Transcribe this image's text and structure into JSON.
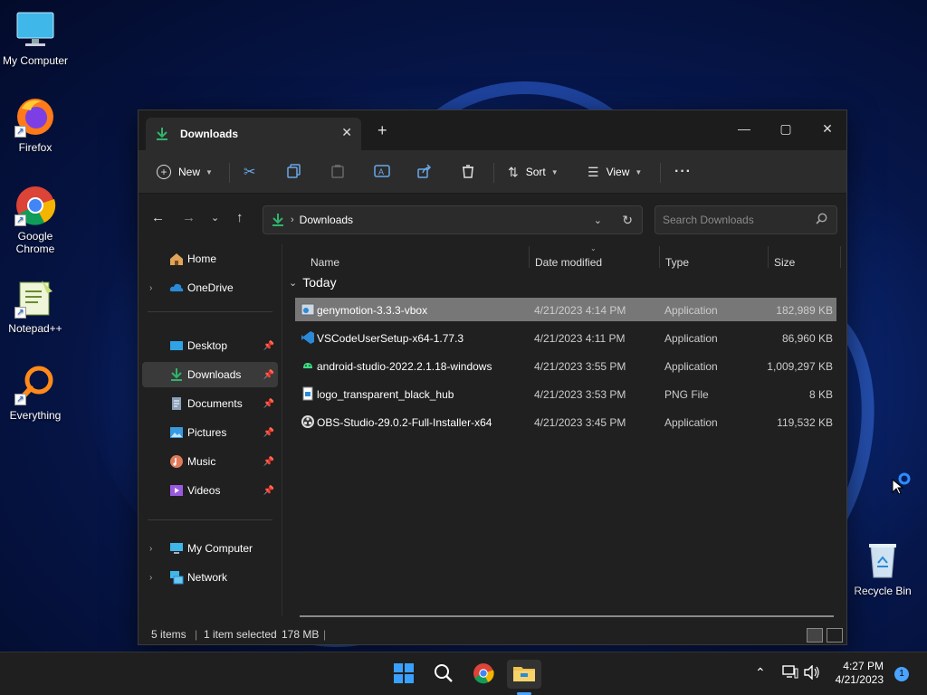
{
  "desktop": {
    "icons": [
      {
        "label": "My Computer",
        "icon": "monitor-icon"
      },
      {
        "label": "Firefox",
        "icon": "firefox-icon"
      },
      {
        "label": "Google Chrome",
        "icon": "chrome-icon"
      },
      {
        "label": "Notepad++",
        "icon": "notepadpp-icon"
      },
      {
        "label": "Everything",
        "icon": "everything-icon"
      },
      {
        "label": "Recycle Bin",
        "icon": "recycle-bin-icon"
      }
    ]
  },
  "window": {
    "tab_title": "Downloads",
    "toolbar": {
      "new_label": "New",
      "sort_label": "Sort",
      "view_label": "View",
      "more_label": "···"
    },
    "address": {
      "crumb": "Downloads",
      "search_placeholder": "Search Downloads"
    },
    "sidebar": {
      "items": [
        {
          "label": "Home"
        },
        {
          "label": "OneDrive"
        },
        {
          "label": "Desktop"
        },
        {
          "label": "Downloads"
        },
        {
          "label": "Documents"
        },
        {
          "label": "Pictures"
        },
        {
          "label": "Music"
        },
        {
          "label": "Videos"
        },
        {
          "label": "My Computer"
        },
        {
          "label": "Network"
        }
      ]
    },
    "columns": {
      "name": "Name",
      "date": "Date modified",
      "type": "Type",
      "size": "Size"
    },
    "group_label": "Today",
    "files": [
      {
        "name": "genymotion-3.3.3-vbox",
        "date": "4/21/2023 4:14 PM",
        "type": "Application",
        "size": "182,989 KB",
        "selected": true
      },
      {
        "name": "VSCodeUserSetup-x64-1.77.3",
        "date": "4/21/2023 4:11 PM",
        "type": "Application",
        "size": "86,960 KB",
        "selected": false
      },
      {
        "name": "android-studio-2022.2.1.18-windows",
        "date": "4/21/2023 3:55 PM",
        "type": "Application",
        "size": "1,009,297 KB",
        "selected": false
      },
      {
        "name": "logo_transparent_black_hub",
        "date": "4/21/2023 3:53 PM",
        "type": "PNG File",
        "size": "8 KB",
        "selected": false
      },
      {
        "name": "OBS-Studio-29.0.2-Full-Installer-x64",
        "date": "4/21/2023 3:45 PM",
        "type": "Application",
        "size": "119,532 KB",
        "selected": false
      }
    ],
    "status": {
      "count": "5 items",
      "selection": "1 item selected",
      "selection_size": "178 MB"
    }
  },
  "taskbar": {
    "time": "4:27 PM",
    "date": "4/21/2023",
    "notification_count": "1"
  }
}
